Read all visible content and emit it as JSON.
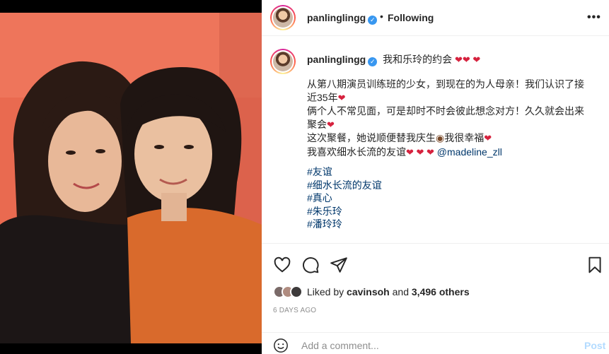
{
  "post": {
    "username": "panlinglingg",
    "follow_status": "Following",
    "more_icon": "more-options-icon"
  },
  "caption": {
    "username": "panlinglingg",
    "title": "我和乐玲的约会",
    "lines": [
      "从第八期演员训练班的少女，到现在的为人母亲！我们认识了接",
      "近35年",
      "俩个人不常见面，可是却时不时会彼此想念对方！久久就会出来",
      "聚会",
      "这次聚餐，她说顺便替我庆生",
      "我很幸福",
      "我喜欢细水长流的友谊",
      "@madeline_zll"
    ],
    "hashtags": [
      "#友谊",
      "#细水长流的友谊",
      "#真心",
      "#朱乐玲",
      "#潘玲玲"
    ]
  },
  "likes": {
    "prefix": "Liked by",
    "user": "cavinsoh",
    "middle": "and",
    "others": "3,496 others"
  },
  "timestamp": "6 DAYS AGO",
  "comment": {
    "placeholder": "Add a comment...",
    "post_label": "Post"
  },
  "colors": {
    "verified": "#3897f0",
    "heart": "#d6223e",
    "link": "#00376b",
    "post_button": "#b3dbff"
  }
}
